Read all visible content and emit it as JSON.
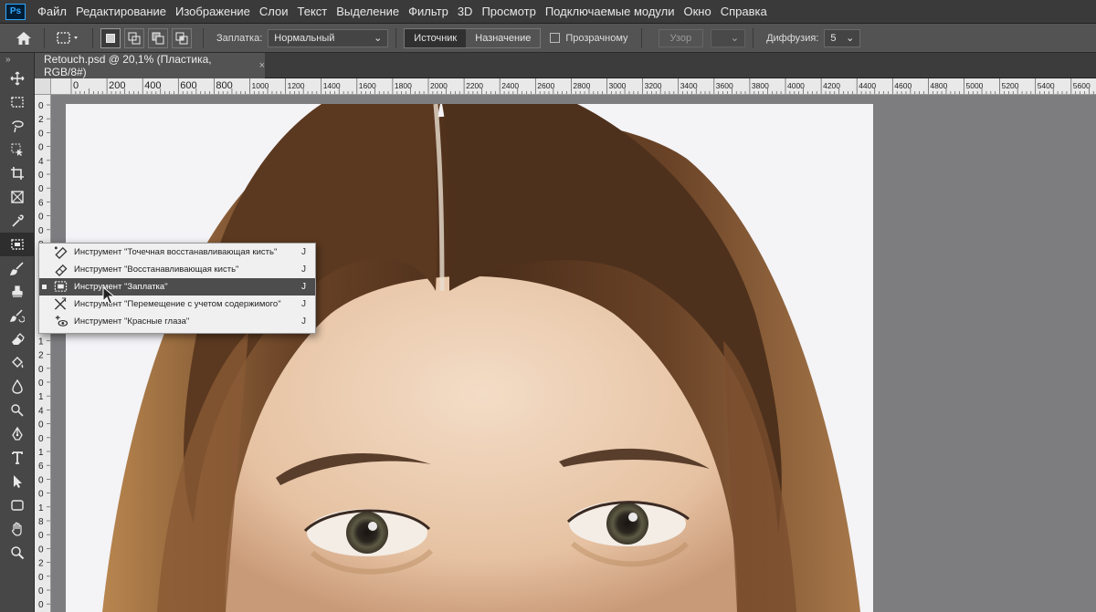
{
  "menubar": {
    "logo": "Ps",
    "items": [
      "Файл",
      "Редактирование",
      "Изображение",
      "Слои",
      "Текст",
      "Выделение",
      "Фильтр",
      "3D",
      "Просмотр",
      "Подключаемые модули",
      "Окно",
      "Справка"
    ]
  },
  "options": {
    "patch_label": "Заплатка:",
    "patch_mode": "Нормальный",
    "source_label": "Источник",
    "destination_label": "Назначение",
    "transparent_label": "Прозрачному",
    "pattern_label": "Узор",
    "diffusion_label": "Диффузия:",
    "diffusion_value": "5"
  },
  "document": {
    "tab_title": "Retouch.psd @ 20,1% (Пластика, RGB/8#)",
    "close": "×"
  },
  "ruler": {
    "top_ticks": [
      "0",
      "200",
      "400",
      "600",
      "800",
      "1000",
      "1200",
      "1400",
      "1600",
      "1800",
      "2000",
      "2200",
      "2400",
      "2600",
      "2800",
      "3000",
      "3200",
      "3400",
      "3600",
      "3800",
      "4000",
      "4200",
      "4400",
      "4600",
      "4800",
      "5000",
      "5200",
      "5400",
      "5600"
    ],
    "left_ticks": [
      "0",
      "2",
      "0",
      "0",
      "4",
      "0",
      "0",
      "6",
      "0",
      "0",
      "8",
      "0",
      "0",
      "1",
      "0",
      "0",
      "0",
      "1",
      "2",
      "0",
      "0",
      "1",
      "4",
      "0",
      "0",
      "1",
      "6",
      "0",
      "0",
      "1",
      "8",
      "0",
      "0",
      "2",
      "0",
      "0",
      "0"
    ]
  },
  "toolbar": {
    "collapse": "»",
    "tools": [
      "move-icon",
      "marquee-icon",
      "lasso-icon",
      "object-select-icon",
      "crop-icon",
      "frame-icon",
      "eyedropper-icon",
      "patch-tool-icon",
      "brush-icon",
      "clone-stamp-icon",
      "history-brush-icon",
      "eraser-icon",
      "paint-bucket-icon",
      "blur-icon",
      "dodge-icon",
      "pen-icon",
      "type-icon",
      "path-select-icon",
      "shape-icon",
      "hand-icon",
      "zoom-icon"
    ]
  },
  "flyout": {
    "items": [
      {
        "label": "Инструмент \"Точечная восстанавливающая кисть\"",
        "key": "J",
        "icon": "spot-healing-icon"
      },
      {
        "label": "Инструмент \"Восстанавливающая кисть\"",
        "key": "J",
        "icon": "healing-brush-icon"
      },
      {
        "label": "Инструмент \"Заплатка\"",
        "key": "J",
        "icon": "patch-icon",
        "active": true
      },
      {
        "label": "Инструмент \"Перемещение с учетом содержимого\"",
        "key": "J",
        "icon": "content-aware-move-icon"
      },
      {
        "label": "Инструмент \"Красные глаза\"",
        "key": "J",
        "icon": "red-eye-icon"
      }
    ]
  },
  "colors": {
    "menubar_bg": "#3a3a3a",
    "optionbar_bg": "#535353",
    "toolbar_bg": "#474747",
    "canvas_bg": "#7d7d80",
    "hair": "#5a3a22",
    "skin": "#e8c9ae"
  }
}
